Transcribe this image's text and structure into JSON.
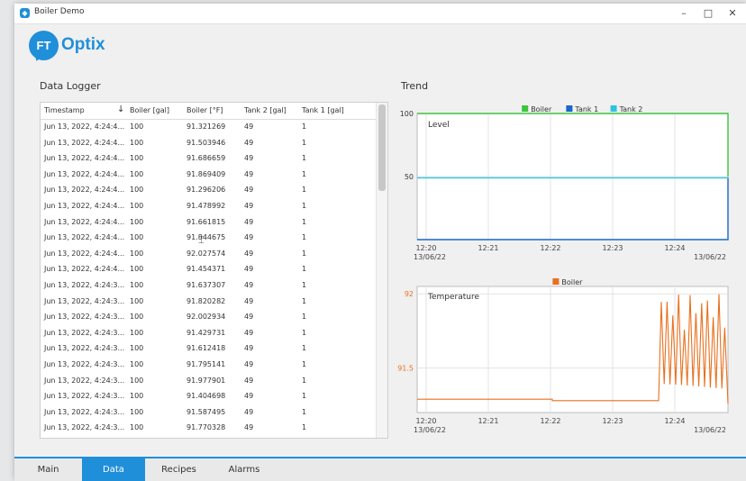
{
  "window": {
    "title": "Boiler Demo",
    "icon": "app-icon",
    "controls": {
      "minimize": "–",
      "maximize": "□",
      "close": "✕"
    }
  },
  "brand": {
    "badge": "FT",
    "name": "Optix"
  },
  "data_logger": {
    "title": "Data Logger",
    "columns": [
      "Timestamp",
      "Boiler [gal]",
      "Boiler [°F]",
      "Tank 2 [gal]",
      "Tank 1 [gal]"
    ],
    "sort_icon": "↓",
    "rows": [
      [
        "Jun 13, 2022, 4:24:4...",
        "100",
        "91.321269",
        "49",
        "1"
      ],
      [
        "Jun 13, 2022, 4:24:4...",
        "100",
        "91.503946",
        "49",
        "1"
      ],
      [
        "Jun 13, 2022, 4:24:4...",
        "100",
        "91.686659",
        "49",
        "1"
      ],
      [
        "Jun 13, 2022, 4:24:4...",
        "100",
        "91.869409",
        "49",
        "1"
      ],
      [
        "Jun 13, 2022, 4:24:4...",
        "100",
        "91.296206",
        "49",
        "1"
      ],
      [
        "Jun 13, 2022, 4:24:4...",
        "100",
        "91.478992",
        "49",
        "1"
      ],
      [
        "Jun 13, 2022, 4:24:4...",
        "100",
        "91.661815",
        "49",
        "1"
      ],
      [
        "Jun 13, 2022, 4:24:4...",
        "100",
        "91.844675",
        "49",
        "1"
      ],
      [
        "Jun 13, 2022, 4:24:4...",
        "100",
        "92.027574",
        "49",
        "1"
      ],
      [
        "Jun 13, 2022, 4:24:4...",
        "100",
        "91.454371",
        "49",
        "1"
      ],
      [
        "Jun 13, 2022, 4:24:3...",
        "100",
        "91.637307",
        "49",
        "1"
      ],
      [
        "Jun 13, 2022, 4:24:3...",
        "100",
        "91.820282",
        "49",
        "1"
      ],
      [
        "Jun 13, 2022, 4:24:3...",
        "100",
        "92.002934",
        "49",
        "1"
      ],
      [
        "Jun 13, 2022, 4:24:3...",
        "100",
        "91.429731",
        "49",
        "1"
      ],
      [
        "Jun 13, 2022, 4:24:3...",
        "100",
        "91.612418",
        "49",
        "1"
      ],
      [
        "Jun 13, 2022, 4:24:3...",
        "100",
        "91.795141",
        "49",
        "1"
      ],
      [
        "Jun 13, 2022, 4:24:3...",
        "100",
        "91.977901",
        "49",
        "1"
      ],
      [
        "Jun 13, 2022, 4:24:3...",
        "100",
        "91.404698",
        "49",
        "1"
      ],
      [
        "Jun 13, 2022, 4:24:3...",
        "100",
        "91.587495",
        "49",
        "1"
      ],
      [
        "Jun 13, 2022, 4:24:3...",
        "100",
        "91.770328",
        "49",
        "1"
      ]
    ]
  },
  "trend": {
    "title": "Trend"
  },
  "tabs": [
    {
      "label": "Main",
      "active": false
    },
    {
      "label": "Data",
      "active": true
    },
    {
      "label": "Recipes",
      "active": false
    },
    {
      "label": "Alarms",
      "active": false
    }
  ],
  "colors": {
    "accent": "#1f8fd9",
    "boiler_level": "#3ec43e",
    "tank1": "#1a66c9",
    "tank2": "#2ec4e0",
    "boiler_temp": "#e8701e"
  },
  "chart_data": [
    {
      "type": "line",
      "title": "Level",
      "legend": [
        "Boiler",
        "Tank 1",
        "Tank 2"
      ],
      "legend_position": "top",
      "x_ticks": [
        {
          "time": "12:20",
          "date": "13/06/22"
        },
        {
          "time": "12:21",
          "date": ""
        },
        {
          "time": "12:22",
          "date": ""
        },
        {
          "time": "12:23",
          "date": ""
        },
        {
          "time": "12:24",
          "date": ""
        }
      ],
      "x_end_label": "13/06/22",
      "x_range_min": [
        12.33,
        12.445
      ],
      "y_ticks": [
        100,
        50
      ],
      "ylim": [
        0,
        100
      ],
      "grid": true,
      "series": [
        {
          "name": "Boiler",
          "x_min": [
            12.33,
            12.4,
            12.423,
            12.4245,
            12.4285,
            12.43,
            12.445
          ],
          "values": [
            100,
            100,
            100,
            50,
            50,
            100,
            100
          ]
        },
        {
          "name": "Tank 1",
          "x_min": [
            12.33,
            12.4,
            12.423,
            12.4245,
            12.4285,
            12.43,
            12.445
          ],
          "values": [
            0,
            0,
            0,
            49,
            49,
            0,
            0
          ]
        },
        {
          "name": "Tank 2",
          "x_min": [
            12.33,
            12.445
          ],
          "values": [
            49,
            49
          ]
        }
      ]
    },
    {
      "type": "line",
      "title": "Temperature",
      "legend": [
        "Boiler"
      ],
      "legend_position": "top",
      "x_ticks": [
        {
          "time": "12:20",
          "date": "13/06/22"
        },
        {
          "time": "12:21",
          "date": ""
        },
        {
          "time": "12:22",
          "date": ""
        },
        {
          "time": "12:23",
          "date": ""
        },
        {
          "time": "12:24",
          "date": ""
        }
      ],
      "x_end_label": "13/06/22",
      "y_ticks": [
        92,
        91.5
      ],
      "ylim": [
        91.2,
        92.05
      ],
      "grid": true,
      "series": [
        {
          "name": "Boiler",
          "pattern": "flat ~91.29 then oscillating 91.3–92.0 after 12:23.7"
        }
      ]
    }
  ]
}
